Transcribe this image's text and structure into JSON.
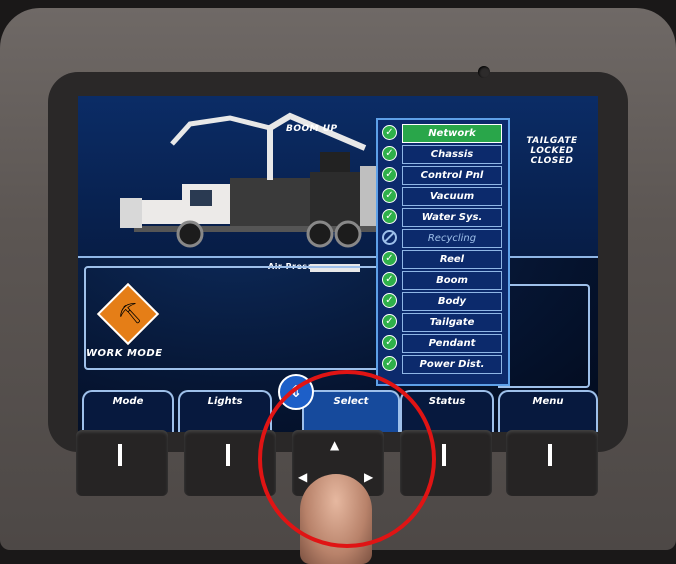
{
  "screen": {
    "boom_status": "BOOM UP",
    "tailgate_status": "TAILGATE LOCKED CLOSED",
    "air_pres_label": "Air Pres:",
    "work_mode_label": "WORK MODE"
  },
  "status_list": [
    {
      "label": "Network",
      "state": "selected"
    },
    {
      "label": "Chassis",
      "state": "ok"
    },
    {
      "label": "Control Pnl",
      "state": "ok"
    },
    {
      "label": "Vacuum",
      "state": "ok"
    },
    {
      "label": "Water Sys.",
      "state": "ok"
    },
    {
      "label": "Recycling",
      "state": "disabled"
    },
    {
      "label": "Reel",
      "state": "ok"
    },
    {
      "label": "Boom",
      "state": "ok"
    },
    {
      "label": "Body",
      "state": "ok"
    },
    {
      "label": "Tailgate",
      "state": "ok"
    },
    {
      "label": "Pendant",
      "state": "ok"
    },
    {
      "label": "Power Dist.",
      "state": "ok"
    }
  ],
  "softkeys": {
    "mode": "Mode",
    "lights": "Lights",
    "select": "Select",
    "status": "Status",
    "menu": "Menu"
  },
  "colors": {
    "selected": "#29a64a",
    "check": "#2fb04a",
    "accent": "#5ea0e8",
    "highlight_circle": "#e01414",
    "work_sign": "#e57e17"
  }
}
